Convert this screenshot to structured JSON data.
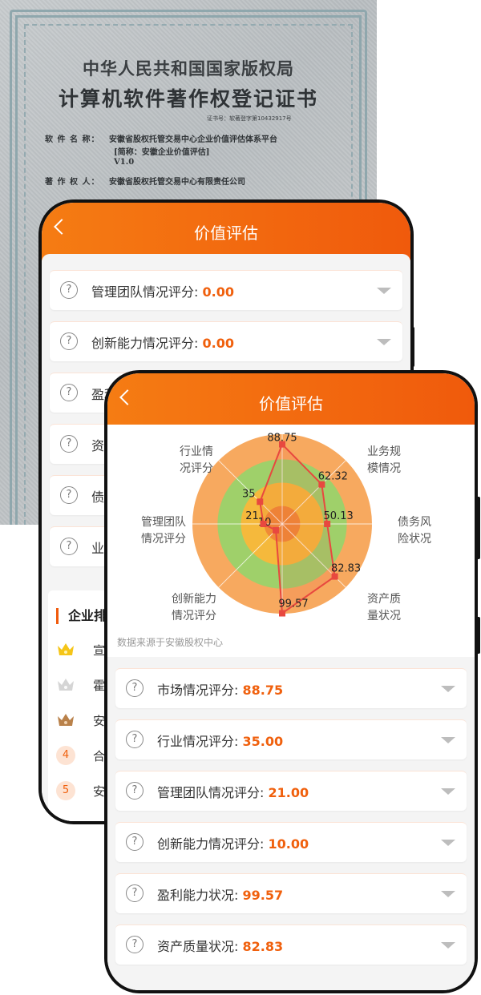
{
  "certificate": {
    "title_line1": "中华人民共和国国家版权局",
    "title_line2": "计算机软件著作权登记证书",
    "cert_no": "证书号：软著登字第10432917号",
    "software_name_label": "软 件 名 称：",
    "software_name": "安徽省股权托管交易中心企业价值评估体系平台",
    "short_name": "[简称：安徽企业价值评估]",
    "version": "V1.0",
    "owner_label": "著 作 权 人：",
    "owner": "安徽省股权托管交易中心有限责任公司"
  },
  "phone_back": {
    "header_title": "价值评估",
    "cards": [
      {
        "label": "管理团队情况评分:",
        "value": "0.00"
      },
      {
        "label": "创新能力情况评分:",
        "value": "0.00"
      },
      {
        "label": "盈利",
        "value": ""
      },
      {
        "label": "资",
        "value": ""
      },
      {
        "label": "债",
        "value": ""
      },
      {
        "label": "业",
        "value": ""
      }
    ],
    "ranking": {
      "title": "企业排",
      "items": [
        {
          "rank": "1",
          "name": "宣城"
        },
        {
          "rank": "2",
          "name": "霍邱"
        },
        {
          "rank": "3",
          "name": "安徽"
        },
        {
          "rank": "4",
          "name": "合肥"
        },
        {
          "rank": "5",
          "name": "安徽"
        }
      ]
    }
  },
  "phone_front": {
    "header_title": "价值评估",
    "source_note": "数据来源于安徽股权中心",
    "cards": [
      {
        "label": "市场情况评分:",
        "value": "88.75"
      },
      {
        "label": "行业情况评分:",
        "value": "35.00"
      },
      {
        "label": "管理团队情况评分:",
        "value": "21.00"
      },
      {
        "label": "创新能力情况评分:",
        "value": "10.00"
      },
      {
        "label": "盈利能力状况:",
        "value": "99.57"
      },
      {
        "label": "资产质量状况:",
        "value": "82.83"
      }
    ]
  },
  "chart_data": {
    "type": "radar",
    "axes": [
      "市场情况评分",
      "业务规模情况",
      "债务风险状况",
      "资产质量状况",
      "盈利能力状况",
      "创新能力情况评分",
      "管理团队情况评分",
      "行业情况评分"
    ],
    "axis_labels": [
      "",
      "业务规\n模情况",
      "债务风\n险状况",
      "资产质\n量状况",
      "",
      "创新能力\n情况评分",
      "管理团队\n情况评分",
      "行业情\n况评分"
    ],
    "values": [
      88.75,
      62.32,
      50.13,
      82.83,
      99.57,
      10,
      21,
      35
    ],
    "value_labels": [
      "88.75",
      "62.32",
      "50.13",
      "82.83",
      "99.57",
      "10",
      "21",
      "35"
    ],
    "range": [
      0,
      100
    ],
    "series_color": "#e8483f",
    "ring_colors": [
      "#f7a95f",
      "#9fd06a",
      "#f5b93c",
      "#f08a36"
    ]
  }
}
